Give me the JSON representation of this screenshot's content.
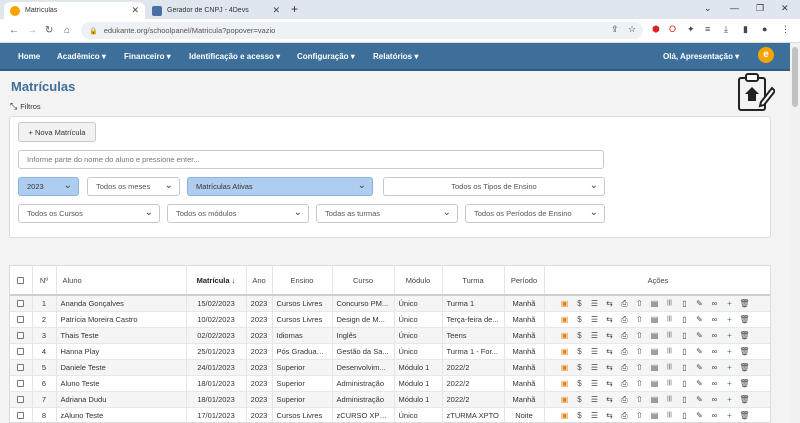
{
  "browser": {
    "tabs": [
      {
        "label": "Matrículas",
        "active": true,
        "favicon_color": "#f5a400"
      },
      {
        "label": "Gerador de CNPJ - 4Devs",
        "active": false,
        "favicon_color": "#4a6fa5"
      }
    ],
    "url": "edukante.org/schoolpanel/Matricula?popover=vazio"
  },
  "nav": {
    "items": [
      "Home",
      "Acadêmico ▾",
      "Financeiro ▾",
      "Identificação e acesso ▾",
      "Configuração ▾",
      "Relatórios ▾"
    ],
    "user": "Olá, Apresentação ▾",
    "logo": "e"
  },
  "page": {
    "title": "Matrículas",
    "filters_label": "Filtros"
  },
  "filters": {
    "new_button": "+ Nova Matrícula",
    "search_placeholder": "Informe parte do nome do aluno e pressione enter...",
    "year": "2023",
    "months": "Todos os meses",
    "status": "Matrículas Ativas",
    "teaching_types": "Todos os Tipos de Ensino",
    "courses": "Todos os Cursos",
    "modules": "Todos os módulos",
    "classes": "Todas as turmas",
    "periods": "Todos os Períodos de Ensino"
  },
  "table": {
    "headers": {
      "num": "Nº",
      "student": "Aluno",
      "date": "Matrícula ↓",
      "year": "Ano",
      "teaching": "Ensino",
      "course": "Curso",
      "module": "Módulo",
      "class": "Turma",
      "period": "Período",
      "actions": "Ações"
    },
    "rows": [
      {
        "num": "1",
        "student": "Ananda Gonçalves",
        "date": "15/02/2023",
        "year": "2023",
        "teaching": "Cursos Livres",
        "course": "Concurso PM...",
        "module": "Único",
        "class": "Turma 1",
        "period": "Manhã"
      },
      {
        "num": "2",
        "student": "Patrícia Moreira Castro",
        "date": "10/02/2023",
        "year": "2023",
        "teaching": "Cursos Livres",
        "course": "Design de M...",
        "module": "Único",
        "class": "Terça-feira de...",
        "period": "Manhã"
      },
      {
        "num": "3",
        "student": "Thais Teste",
        "date": "02/02/2023",
        "year": "2023",
        "teaching": "Idiomas",
        "course": "Inglês",
        "module": "Único",
        "class": "Teens",
        "period": "Manhã"
      },
      {
        "num": "4",
        "student": "Hanna Play",
        "date": "25/01/2023",
        "year": "2023",
        "teaching": "Pós Graduação",
        "course": "Gestão da Sa...",
        "module": "Único",
        "class": "Turma 1 - For...",
        "period": "Manhã"
      },
      {
        "num": "5",
        "student": "Daniele Teste",
        "date": "24/01/2023",
        "year": "2023",
        "teaching": "Superior",
        "course": "Desenvolvim...",
        "module": "Módulo 1",
        "class": "2022/2",
        "period": "Manhã"
      },
      {
        "num": "6",
        "student": "Aluno Teste",
        "date": "18/01/2023",
        "year": "2023",
        "teaching": "Superior",
        "course": "Administração",
        "module": "Módulo 1",
        "class": "2022/2",
        "period": "Manhã"
      },
      {
        "num": "7",
        "student": "Adriana Dudu",
        "date": "18/01/2023",
        "year": "2023",
        "teaching": "Superior",
        "course": "Administração",
        "module": "Módulo 1",
        "class": "2022/2",
        "period": "Manhã"
      },
      {
        "num": "8",
        "student": "zAluno Teste",
        "date": "17/01/2023",
        "year": "2023",
        "teaching": "Cursos Livres",
        "course": "zCURSO XPTO",
        "module": "Único",
        "class": "zTURMA XPTO",
        "period": "Noite"
      }
    ],
    "action_icons": [
      "profile-icon",
      "dollar-icon",
      "checklist-icon",
      "transfer-icon",
      "printer-icon",
      "upload-icon",
      "id-card-icon",
      "barcode-icon",
      "document-icon",
      "contract-icon",
      "link-icon",
      "add-user-icon",
      "trash-icon"
    ]
  }
}
